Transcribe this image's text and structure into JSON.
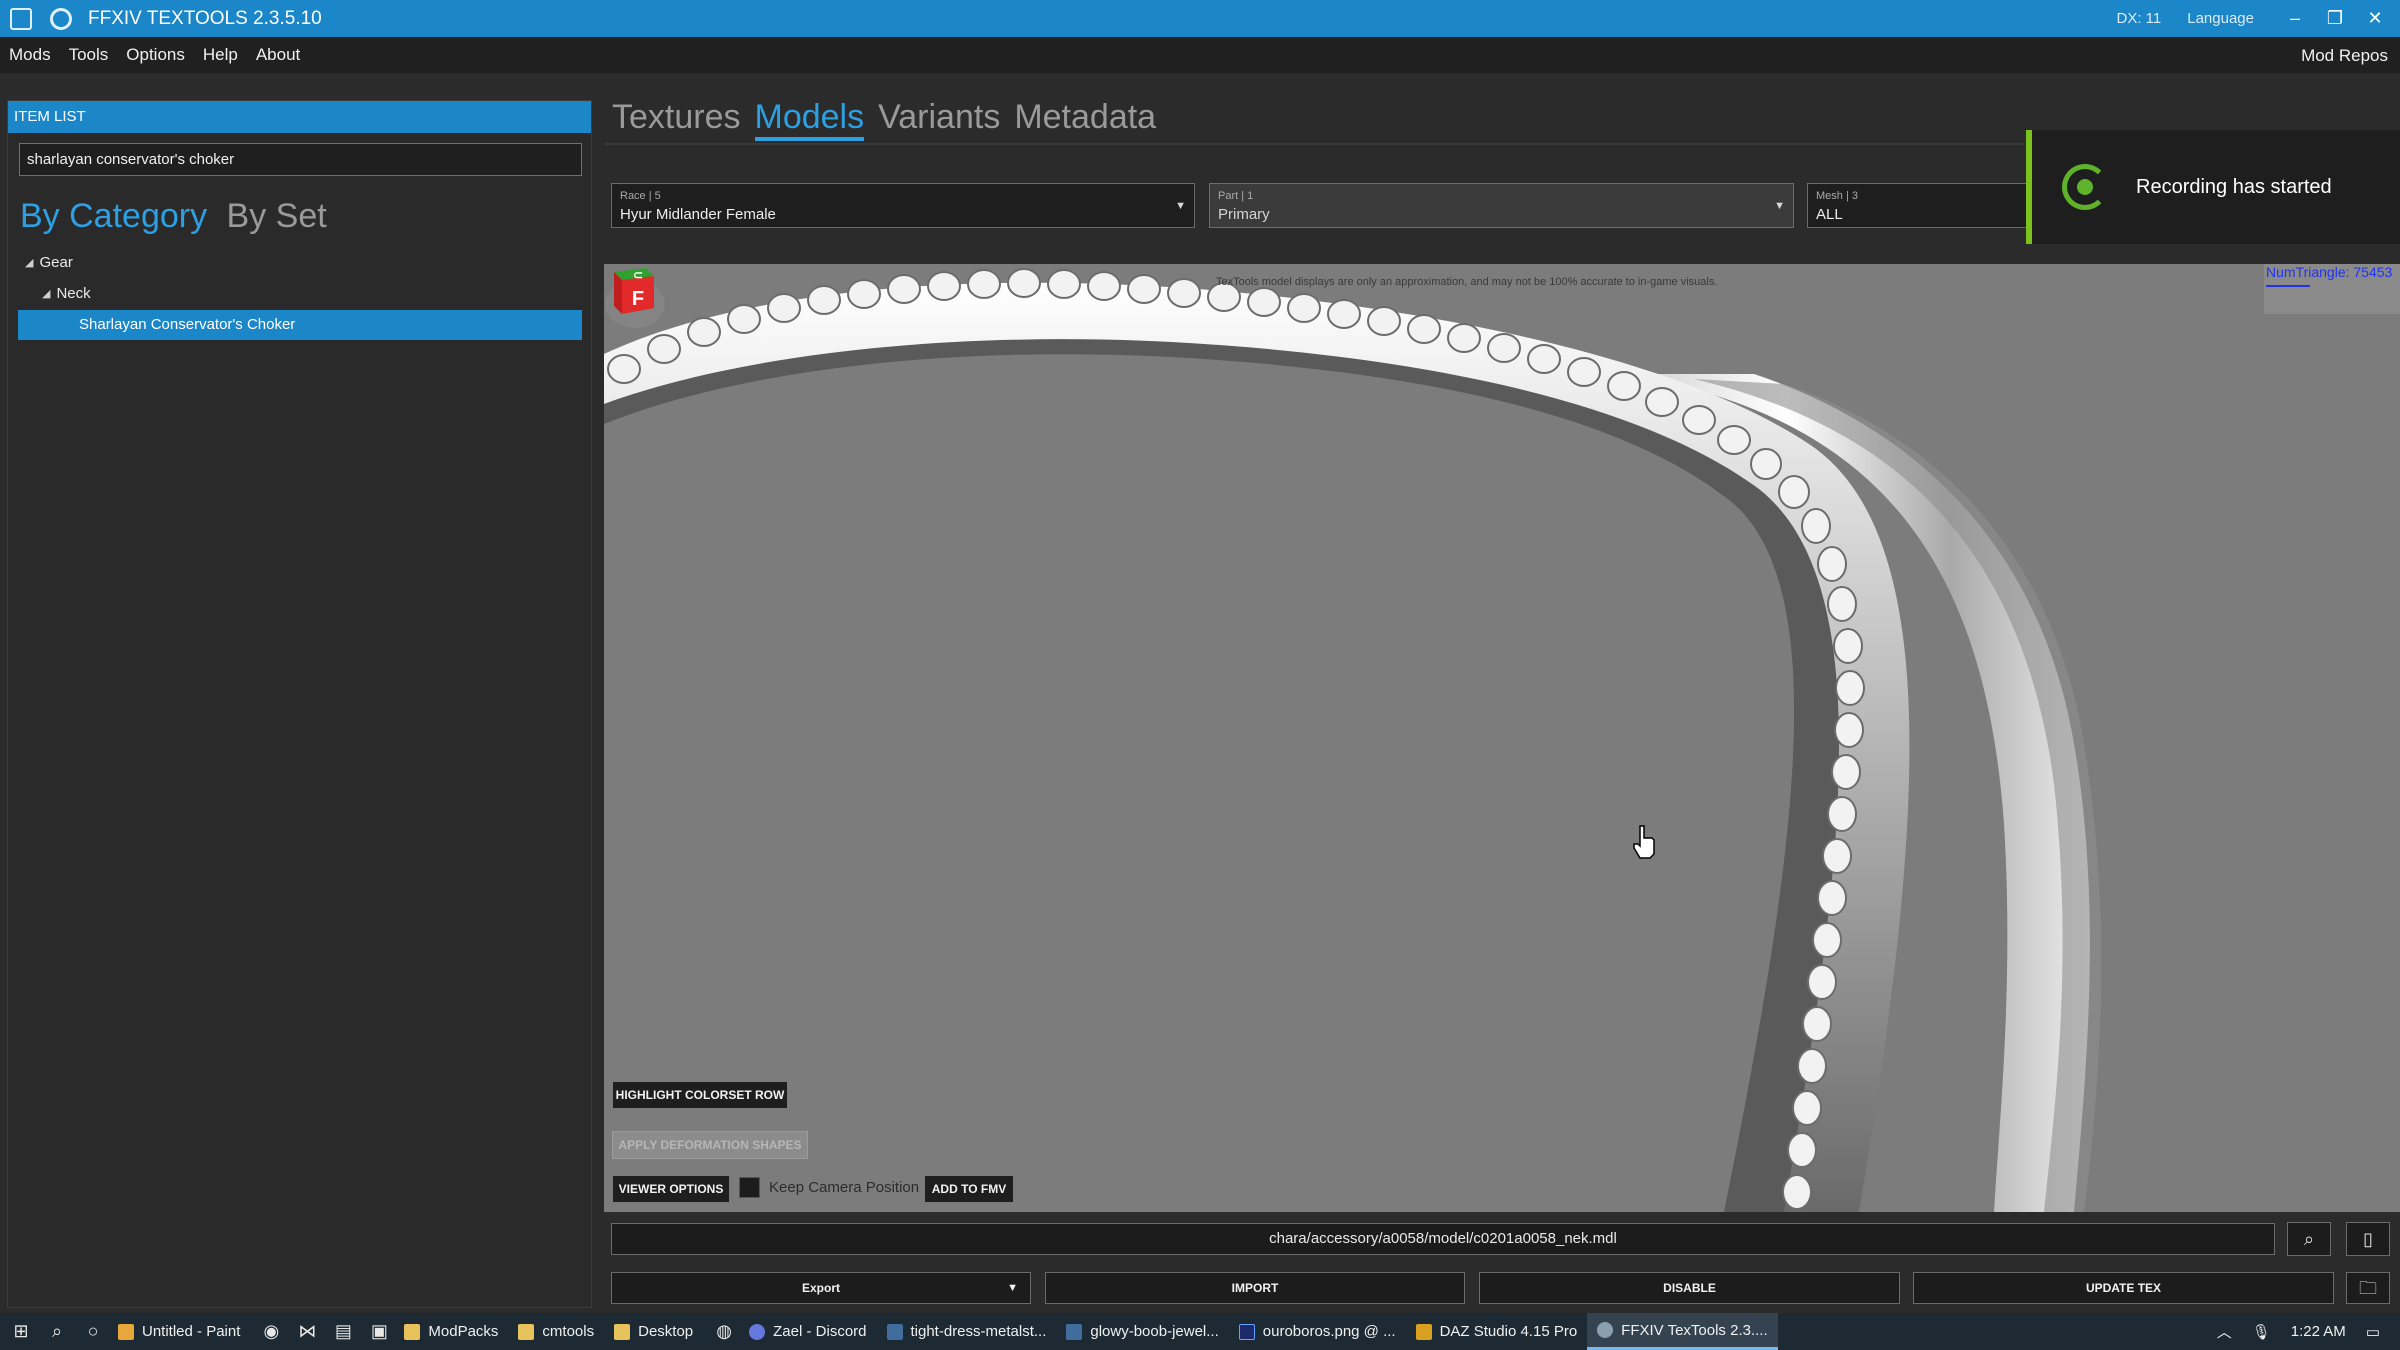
{
  "window": {
    "title": "FFXIV TEXTOOLS 2.3.5.10",
    "dx": "DX: 11",
    "language": "Language",
    "controls": {
      "minimize": "–",
      "restore": "❐",
      "close": "✕"
    }
  },
  "menu": {
    "items": [
      "Mods",
      "Tools",
      "Options",
      "Help",
      "About"
    ],
    "right": "Mod Repos"
  },
  "item_list": {
    "header": "ITEM LIST",
    "search_value": "sharlayan conservator's choker",
    "tabs": {
      "active": "By Category",
      "inactive": "By Set"
    },
    "tree": {
      "gear": "Gear",
      "neck": "Neck",
      "selected_item": "Sharlayan Conservator's Choker"
    }
  },
  "main_tabs": [
    "Textures",
    "Models",
    "Variants",
    "Metadata"
  ],
  "dropdowns": {
    "race": {
      "label": "Race  |  5",
      "value": "Hyur Midlander Female"
    },
    "part": {
      "label": "Part  |  1",
      "value": "Primary"
    },
    "mesh": {
      "label": "Mesh  |  3",
      "value": "ALL"
    }
  },
  "toast": {
    "text": "Recording has started",
    "accent": "#7cc21e"
  },
  "viewport": {
    "disclaimer": "TexTools model displays are only an approximation, and may not be 100% accurate to in-game visuals.",
    "num_triangle": "NumTriangle: 75453",
    "buttons": {
      "highlight": "HIGHLIGHT COLORSET ROW",
      "apply_shapes": "APPLY DEFORMATION SHAPES",
      "viewer_options": "VIEWER OPTIONS",
      "add_fmv": "ADD TO FMV"
    },
    "keep_camera": {
      "label": "Keep Camera Position",
      "checked": false
    },
    "axis_cube": {
      "top_letter": "⊂",
      "front_letter": "F"
    }
  },
  "path": "chara/accessory/a0058/model/c0201a0058_nek.mdl",
  "icons": {
    "search": "search-icon",
    "open_file": "file-icon",
    "folder": "folder-icon"
  },
  "bottom_buttons": {
    "export": "Export",
    "import": "IMPORT",
    "disable": "DISABLE",
    "update_tex": "UPDATE TEX"
  },
  "taskbar": {
    "apps": [
      "Untitled - Paint",
      "ModPacks",
      "cmtools",
      "Desktop",
      "Zael - Discord",
      "tight-dress-metalst...",
      "glowy-boob-jewel...",
      "ouroboros.png @ ...",
      "DAZ Studio 4.15 Pro",
      "FFXIV TexTools 2.3...."
    ],
    "time": "1:22 AM"
  },
  "colors": {
    "accent": "#1b86c8",
    "active_tab": "#2d9fe3",
    "background": "#2b2b2b",
    "viewport": "#7c7c7c"
  }
}
